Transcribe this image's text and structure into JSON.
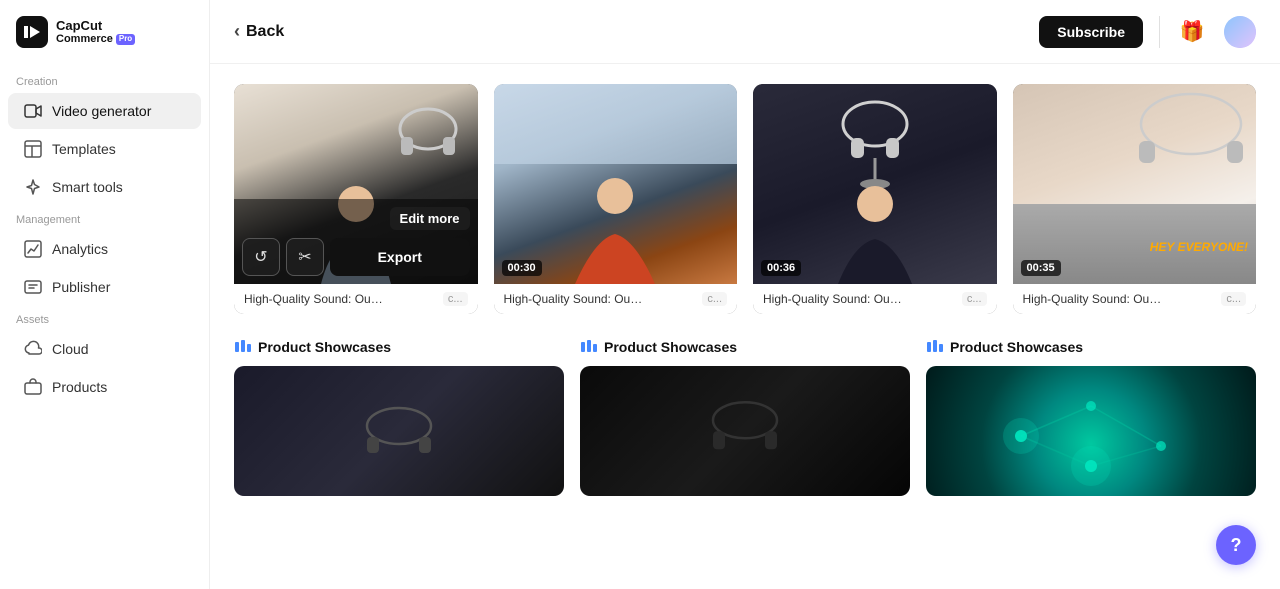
{
  "sidebar": {
    "logo": {
      "capcut": "CapCut",
      "commerce": "Commerce",
      "pro": "Pro"
    },
    "sections": [
      {
        "label": "Creation",
        "items": [
          {
            "id": "video-generator",
            "label": "Video generator",
            "active": true
          },
          {
            "id": "templates",
            "label": "Templates",
            "active": false
          },
          {
            "id": "smart-tools",
            "label": "Smart tools",
            "active": false
          }
        ]
      },
      {
        "label": "Management",
        "items": [
          {
            "id": "analytics",
            "label": "Analytics",
            "active": false
          },
          {
            "id": "publisher",
            "label": "Publisher",
            "active": false
          }
        ]
      },
      {
        "label": "Assets",
        "items": [
          {
            "id": "cloud",
            "label": "Cloud",
            "active": false
          },
          {
            "id": "products",
            "label": "Products",
            "active": false
          }
        ]
      }
    ]
  },
  "header": {
    "back_label": "Back",
    "subscribe_label": "Subscribe"
  },
  "video_row": {
    "cards": [
      {
        "id": "card-1",
        "title": "High-Quality Sound: Our hea...",
        "tag": "c...",
        "duration": null,
        "active": true,
        "edit_more": "Edit more",
        "refresh_icon": "↺",
        "scissors_icon": "✂",
        "export_label": "Export"
      },
      {
        "id": "card-2",
        "title": "High-Quality Sound: Our hea...",
        "tag": "c...",
        "duration": "00:30",
        "active": false
      },
      {
        "id": "card-3",
        "title": "High-Quality Sound: Our hea...",
        "tag": "c...",
        "duration": "00:36",
        "active": false
      },
      {
        "id": "card-4",
        "title": "High-Quality Sound: Our hea...",
        "tag": "c...",
        "duration": "00:35",
        "active": false,
        "hey_text": "HEY EVERYONE!"
      }
    ]
  },
  "product_showcases_row": {
    "sections": [
      {
        "id": "showcase-1",
        "label": "Product Showcases"
      },
      {
        "id": "showcase-2",
        "label": "Product Showcases"
      },
      {
        "id": "showcase-3",
        "label": "Product Showcases"
      }
    ]
  },
  "help": {
    "label": "?"
  }
}
